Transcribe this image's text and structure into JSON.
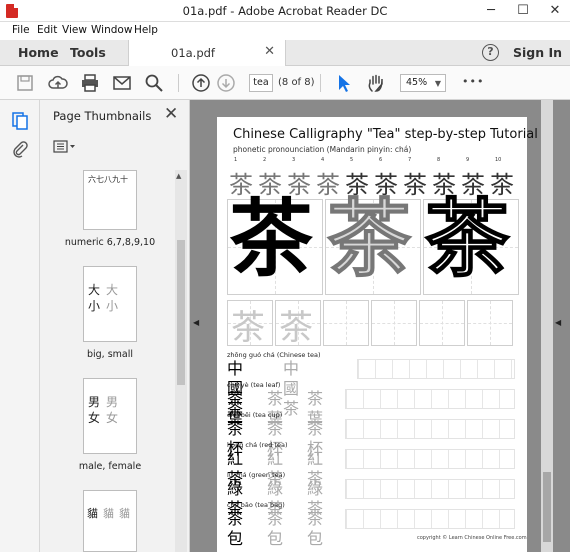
{
  "window": {
    "title": "01a.pdf - Adobe Acrobat Reader DC",
    "minimize": "─",
    "maximize": "☐",
    "close": "✕"
  },
  "menu": [
    "File",
    "Edit",
    "View",
    "Window",
    "Help"
  ],
  "tabs": {
    "home": "Home",
    "tools": "Tools",
    "document": "01a.pdf",
    "document_close": "✕",
    "help": "?",
    "sign_in": "Sign In"
  },
  "toolbar": {
    "search_value": "tea",
    "page_count": "(8 of 8)",
    "zoom": "45%",
    "more": "•••"
  },
  "thumbnail_panel": {
    "title": "Page Thumbnails",
    "close": "✕",
    "items": [
      {
        "label": "numeric 6,7,8,9,10",
        "chars": "六七八九十"
      },
      {
        "label": "big, small",
        "chars": [
          "大",
          "小",
          "大",
          "小"
        ]
      },
      {
        "label": "male, female",
        "chars": [
          "男",
          "女",
          "男",
          "女"
        ]
      },
      {
        "label": "",
        "chars": [
          "貓",
          "貓",
          "貓"
        ]
      }
    ]
  },
  "pdf_page": {
    "title": "Chinese Calligraphy \"Tea\" step-by-step Tutorial",
    "subtitle": "phonetic pronounciation (Mandarin pinyin: chá)",
    "stroke_numbers": [
      "1",
      "2",
      "3",
      "4",
      "5",
      "6",
      "7",
      "8",
      "9",
      "10"
    ],
    "character": "茶",
    "vocabulary": [
      {
        "pinyin": "zhōng guó chá  (Chinese tea)",
        "word": "中國茶"
      },
      {
        "pinyin": "chá    yè   (tea leaf)",
        "word": "茶葉"
      },
      {
        "pinyin": "chá   bēi  (tea cup)",
        "word": "茶杯"
      },
      {
        "pinyin": "hóng  chá  (red tea)",
        "word": "紅茶"
      },
      {
        "pinyin": "lǜ    chá  (green tea)",
        "word": "綠茶"
      },
      {
        "pinyin": "chá   bāo  (tea bag)",
        "word": "茶包"
      }
    ],
    "copyright": "copyright © Learn Chinese Online Free.com"
  }
}
